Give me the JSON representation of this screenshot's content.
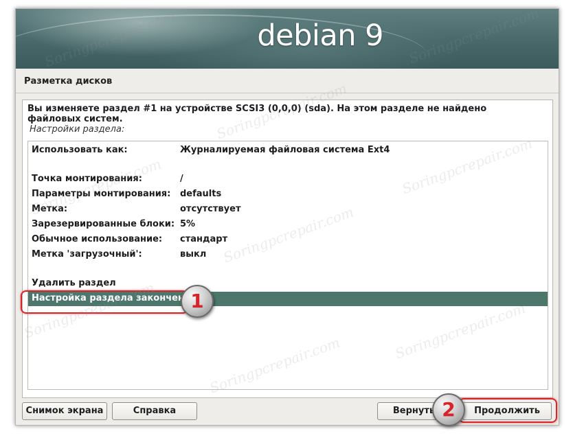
{
  "banner": {
    "title": "debian 9"
  },
  "header": {
    "title": "Разметка дисков"
  },
  "main": {
    "description": "Вы изменяете раздел #1 на устройстве SCSI3 (0,0,0) (sda). На этом разделе не найдено файловых систем.",
    "subheading": "Настройки раздела:",
    "settings": [
      {
        "label": "Использовать как:",
        "value": "Журналируемая файловая система Ext4"
      },
      {
        "label": "Точка монтирования:",
        "value": "/"
      },
      {
        "label": "Параметры монтирования:",
        "value": "defaults"
      },
      {
        "label": "Метка:",
        "value": "отсутствует"
      },
      {
        "label": "Зарезервированные блоки:",
        "value": "5%"
      },
      {
        "label": "Обычное использование:",
        "value": "стандарт"
      },
      {
        "label": "Метка 'загрузочный':",
        "value": "выкл"
      }
    ],
    "actions": [
      {
        "label": "Удалить раздел"
      },
      {
        "label": "Настройка раздела закончена",
        "selected": true
      }
    ]
  },
  "buttons": {
    "screenshot": "Снимок экрана",
    "help": "Справка",
    "back": "Вернуть",
    "continue": "Продолжить"
  },
  "annotations": {
    "marker1": "1",
    "marker2": "2"
  },
  "watermark": "Soringpcrepair.com",
  "colors": {
    "selection": "#4c776a",
    "highlight": "#d8232a",
    "banner": "#48686a"
  }
}
